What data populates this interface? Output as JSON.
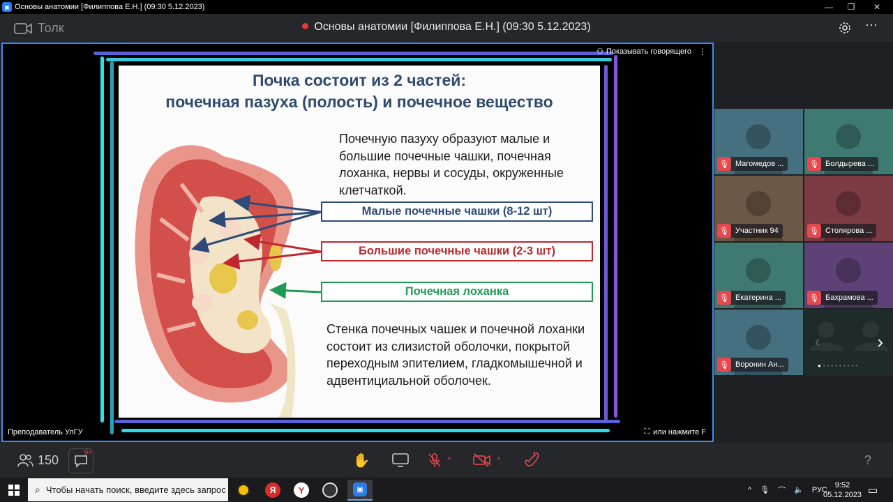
{
  "window": {
    "title": "Основы анатомии [Филиппова Е.Н.] (09:30 5.12.2023)",
    "app_icon": "zoom-icon",
    "controls": [
      "minimize",
      "maximize",
      "close"
    ]
  },
  "header": {
    "logo_text": "Толк",
    "meeting_title": "Основы анатомии [Филиппова Е.Н.] (09:30 5.12.2023)",
    "recording_color": "#e53935",
    "icons": [
      "settings-icon",
      "more-icon"
    ]
  },
  "stage": {
    "show_speaker_label": "Показывать говорящего",
    "presenter_name": "Преподаватель УлГУ",
    "fullscreen_hint": "или нажмите F",
    "border_color": "#3d8bef"
  },
  "slide": {
    "title_line1": "Почка состоит из 2 частей:",
    "title_line2": "почечная пазуха (полость) и почечное вещество",
    "paragraph1": "Почечную пазуху образуют малые и большие почечные чашки, почечная лоханка, нервы и сосуды, окруженные клетчаткой.",
    "labels": [
      {
        "text": "Малые почечные чашки (8-12 шт)",
        "color": "#2e4a78"
      },
      {
        "text": "Большие почечные чашки (2-3 шт)",
        "color": "#c0262d"
      },
      {
        "text": "Почечная лоханка",
        "color": "#1f9a55"
      }
    ],
    "paragraph2": "Стенка почечных чашек и почечной лоханки состоит из слизистой оболочки, покрытой переходным эпителием, гладкомышечной и адвентициальной оболочек."
  },
  "participants": [
    {
      "name": "Магомедов ...",
      "bg": "#44707f"
    },
    {
      "name": "Болдырева ...",
      "bg": "#3f7a72"
    },
    {
      "name": "Участник 94",
      "bg": "#6c5846"
    },
    {
      "name": "Столярова ...",
      "bg": "#7d3b44"
    },
    {
      "name": "Екатерина ...",
      "bg": "#3f7a72"
    },
    {
      "name": "Бахрамова ...",
      "bg": "#5e4277"
    },
    {
      "name": "Воронин Ан...",
      "bg": "#44707f"
    }
  ],
  "toolbar": {
    "participants_count": "150",
    "chat_badge": "9+",
    "help": "?"
  },
  "taskbar": {
    "search_placeholder": "Чтобы начать поиск, введите здесь запрос",
    "language": "РУС",
    "time": "9:52",
    "date": "05.12.2023"
  }
}
